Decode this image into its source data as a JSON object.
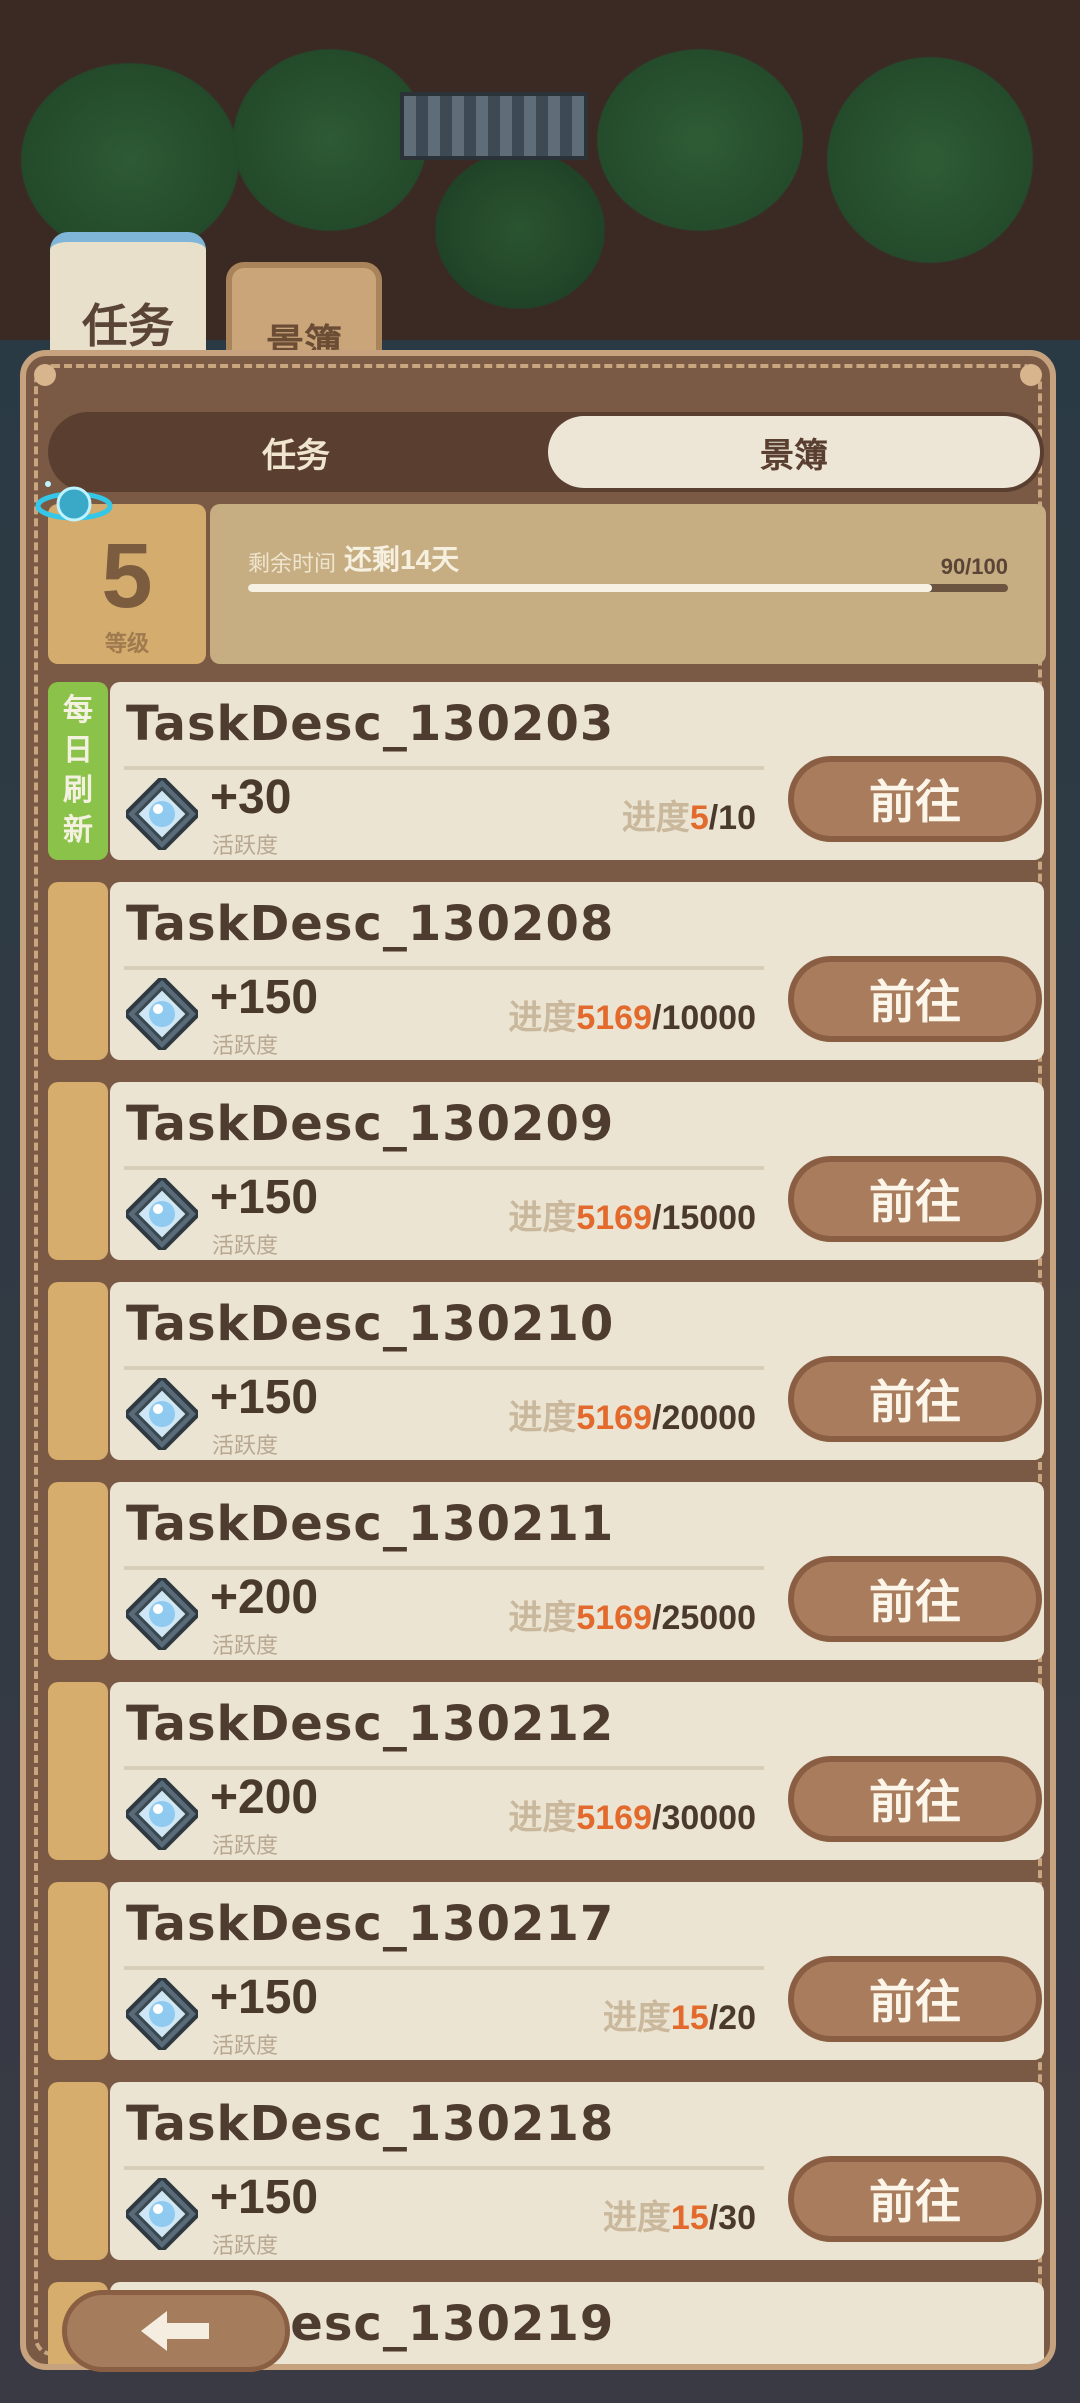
{
  "tabs": {
    "main_tab": "任务",
    "second_tab": "景簿"
  },
  "segment": {
    "left": "任务",
    "right": "景簿"
  },
  "level": {
    "value": "5",
    "label": "等级"
  },
  "season": {
    "remaining_label": "剩余时间",
    "remaining_value": "还剩14天",
    "progress_text": "90/100",
    "progress_fraction": 0.9
  },
  "tasks": [
    {
      "desc": "TaskDesc_130203",
      "tag": [
        "每",
        "日",
        "刷",
        "新"
      ],
      "reward": "+30",
      "reward_label": "活跃度",
      "progress_label": "进度",
      "current": "5",
      "total": "/10",
      "button": "前往"
    },
    {
      "desc": "TaskDesc_130208",
      "tag": [],
      "reward": "+150",
      "reward_label": "活跃度",
      "progress_label": "进度",
      "current": "5169",
      "total": "/10000",
      "button": "前往"
    },
    {
      "desc": "TaskDesc_130209",
      "tag": [],
      "reward": "+150",
      "reward_label": "活跃度",
      "progress_label": "进度",
      "current": "5169",
      "total": "/15000",
      "button": "前往"
    },
    {
      "desc": "TaskDesc_130210",
      "tag": [],
      "reward": "+150",
      "reward_label": "活跃度",
      "progress_label": "进度",
      "current": "5169",
      "total": "/20000",
      "button": "前往"
    },
    {
      "desc": "TaskDesc_130211",
      "tag": [],
      "reward": "+200",
      "reward_label": "活跃度",
      "progress_label": "进度",
      "current": "5169",
      "total": "/25000",
      "button": "前往"
    },
    {
      "desc": "TaskDesc_130212",
      "tag": [],
      "reward": "+200",
      "reward_label": "活跃度",
      "progress_label": "进度",
      "current": "5169",
      "total": "/30000",
      "button": "前往"
    },
    {
      "desc": "TaskDesc_130217",
      "tag": [],
      "reward": "+150",
      "reward_label": "活跃度",
      "progress_label": "进度",
      "current": "15",
      "total": "/20",
      "button": "前往"
    },
    {
      "desc": "TaskDesc_130218",
      "tag": [],
      "reward": "+150",
      "reward_label": "活跃度",
      "progress_label": "进度",
      "current": "15",
      "total": "/30",
      "button": "前往"
    },
    {
      "desc": "TaskDesc_130219",
      "tag": [],
      "reward": "",
      "reward_label": "",
      "progress_label": "",
      "current": "",
      "total": "",
      "button": ""
    }
  ],
  "icons": {
    "reward": "gem-icon",
    "back": "back-arrow-icon",
    "orbit": "planet-icon"
  }
}
